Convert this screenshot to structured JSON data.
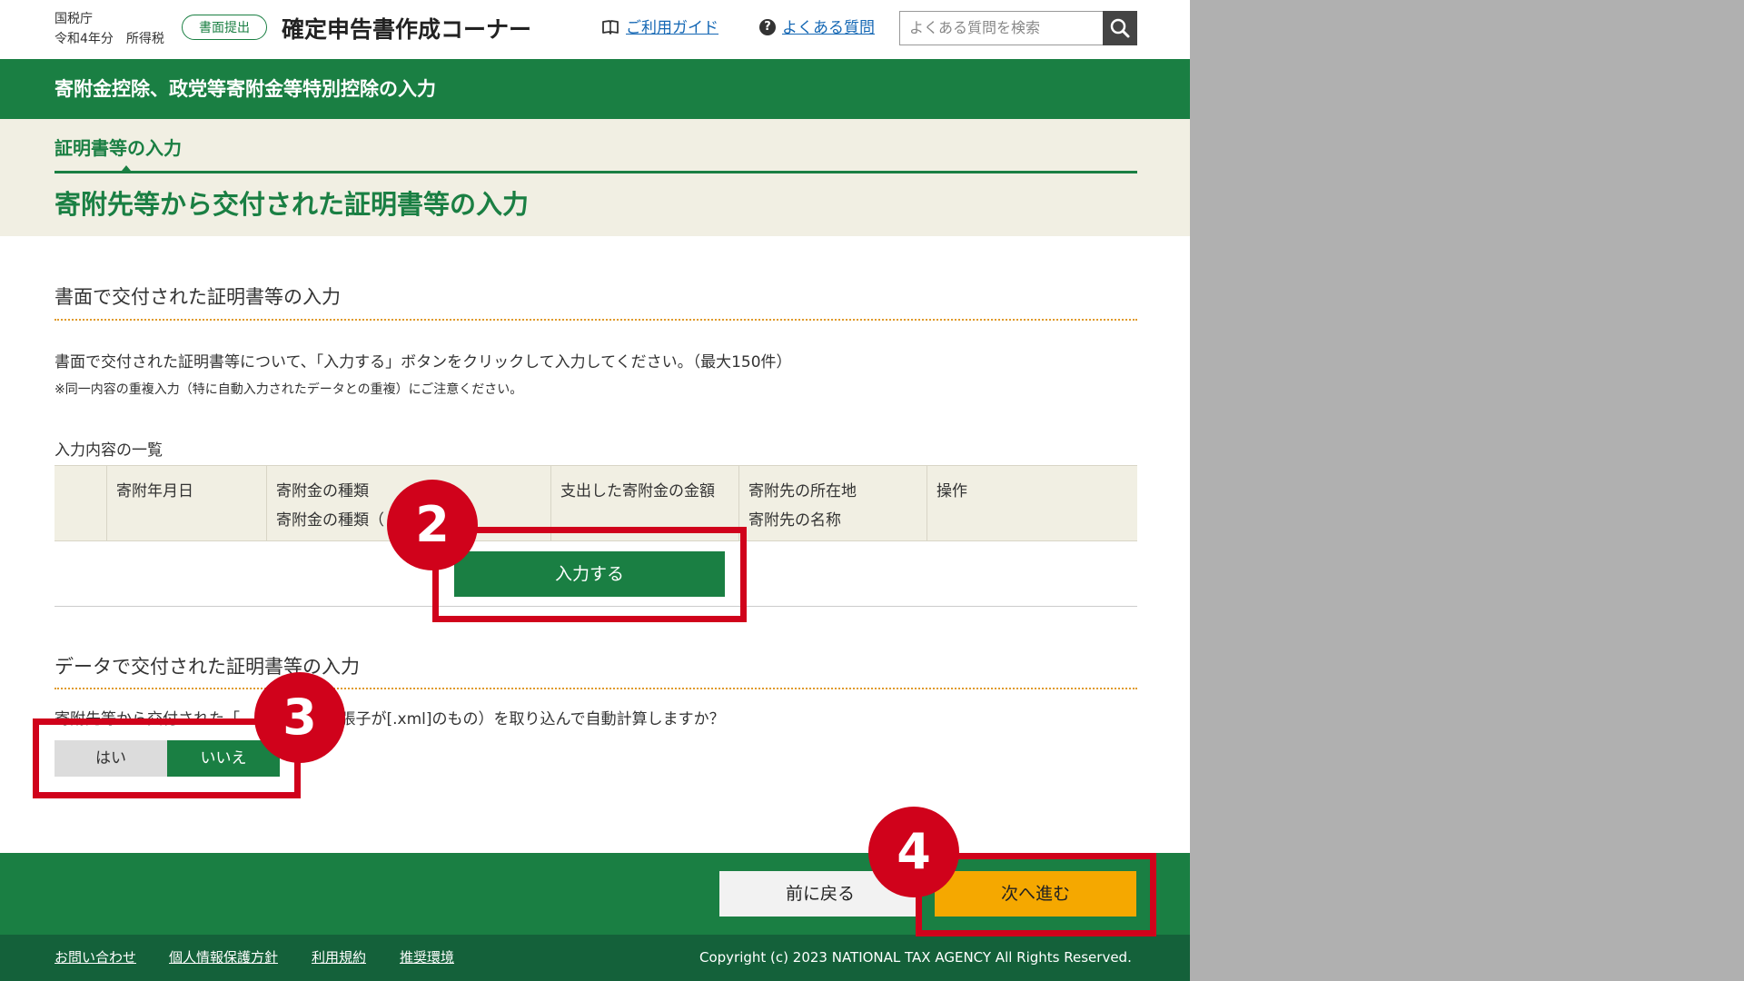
{
  "header": {
    "org": "国税庁",
    "year_tax": "令和4年分　所得税",
    "badge": "書面提出",
    "title": "確定申告書作成コーナー",
    "guide_link": "ご利用ガイド",
    "faq_icon": "?",
    "faq_link": "よくある質問",
    "search_placeholder": "よくある質問を検索",
    "search_icon": "search-icon"
  },
  "bar_title": "寄附金控除、政党等寄附金等特別控除の入力",
  "section_label": "証明書等の入力",
  "page_title": "寄附先等から交付された証明書等の入力",
  "paper_section": {
    "heading": "書面で交付された証明書等の入力",
    "instruction": "書面で交付された証明書等について、「入力する」ボタンをクリックして入力してください。（最大150件）",
    "note": "※同一内容の重複入力（特に自動入力されたデータとの重複）にご注意ください。",
    "list_caption": "入力内容の一覧",
    "columns": [
      {
        "line1": "",
        "line2": ""
      },
      {
        "line1": "寄附年月日",
        "line2": ""
      },
      {
        "line1": "寄附金の種類",
        "line2": "寄附金の種類（"
      },
      {
        "line1": "支出した寄附金の金額",
        "line2": ""
      },
      {
        "line1": "寄附先の所在地",
        "line2": "寄附先の名称"
      },
      {
        "line1": "操作",
        "line2": ""
      }
    ],
    "input_button": "入力する"
  },
  "data_section": {
    "heading": "データで交付された証明書等の入力",
    "question": "寄附先等から交付された「　　　　　（拡張子が[.xml]のもの）を取り込んで自動計算しますか？",
    "yes": "はい",
    "no": "いいえ",
    "selected": "いいえ"
  },
  "nav": {
    "back": "前に戻る",
    "next": "次へ進む"
  },
  "footer": {
    "links": [
      "お問い合わせ",
      "個人情報保護方針",
      "利用規約",
      "推奨環境"
    ],
    "copyright": "Copyright (c) 2023 NATIONAL TAX AGENCY All Rights Reserved."
  },
  "annotations": {
    "step2": "2",
    "step3": "3",
    "step4": "4",
    "color": "#d0021b"
  },
  "colors": {
    "brand_green": "#1a7f43",
    "next_button": "#f5a800",
    "beige": "#f1efe3"
  }
}
